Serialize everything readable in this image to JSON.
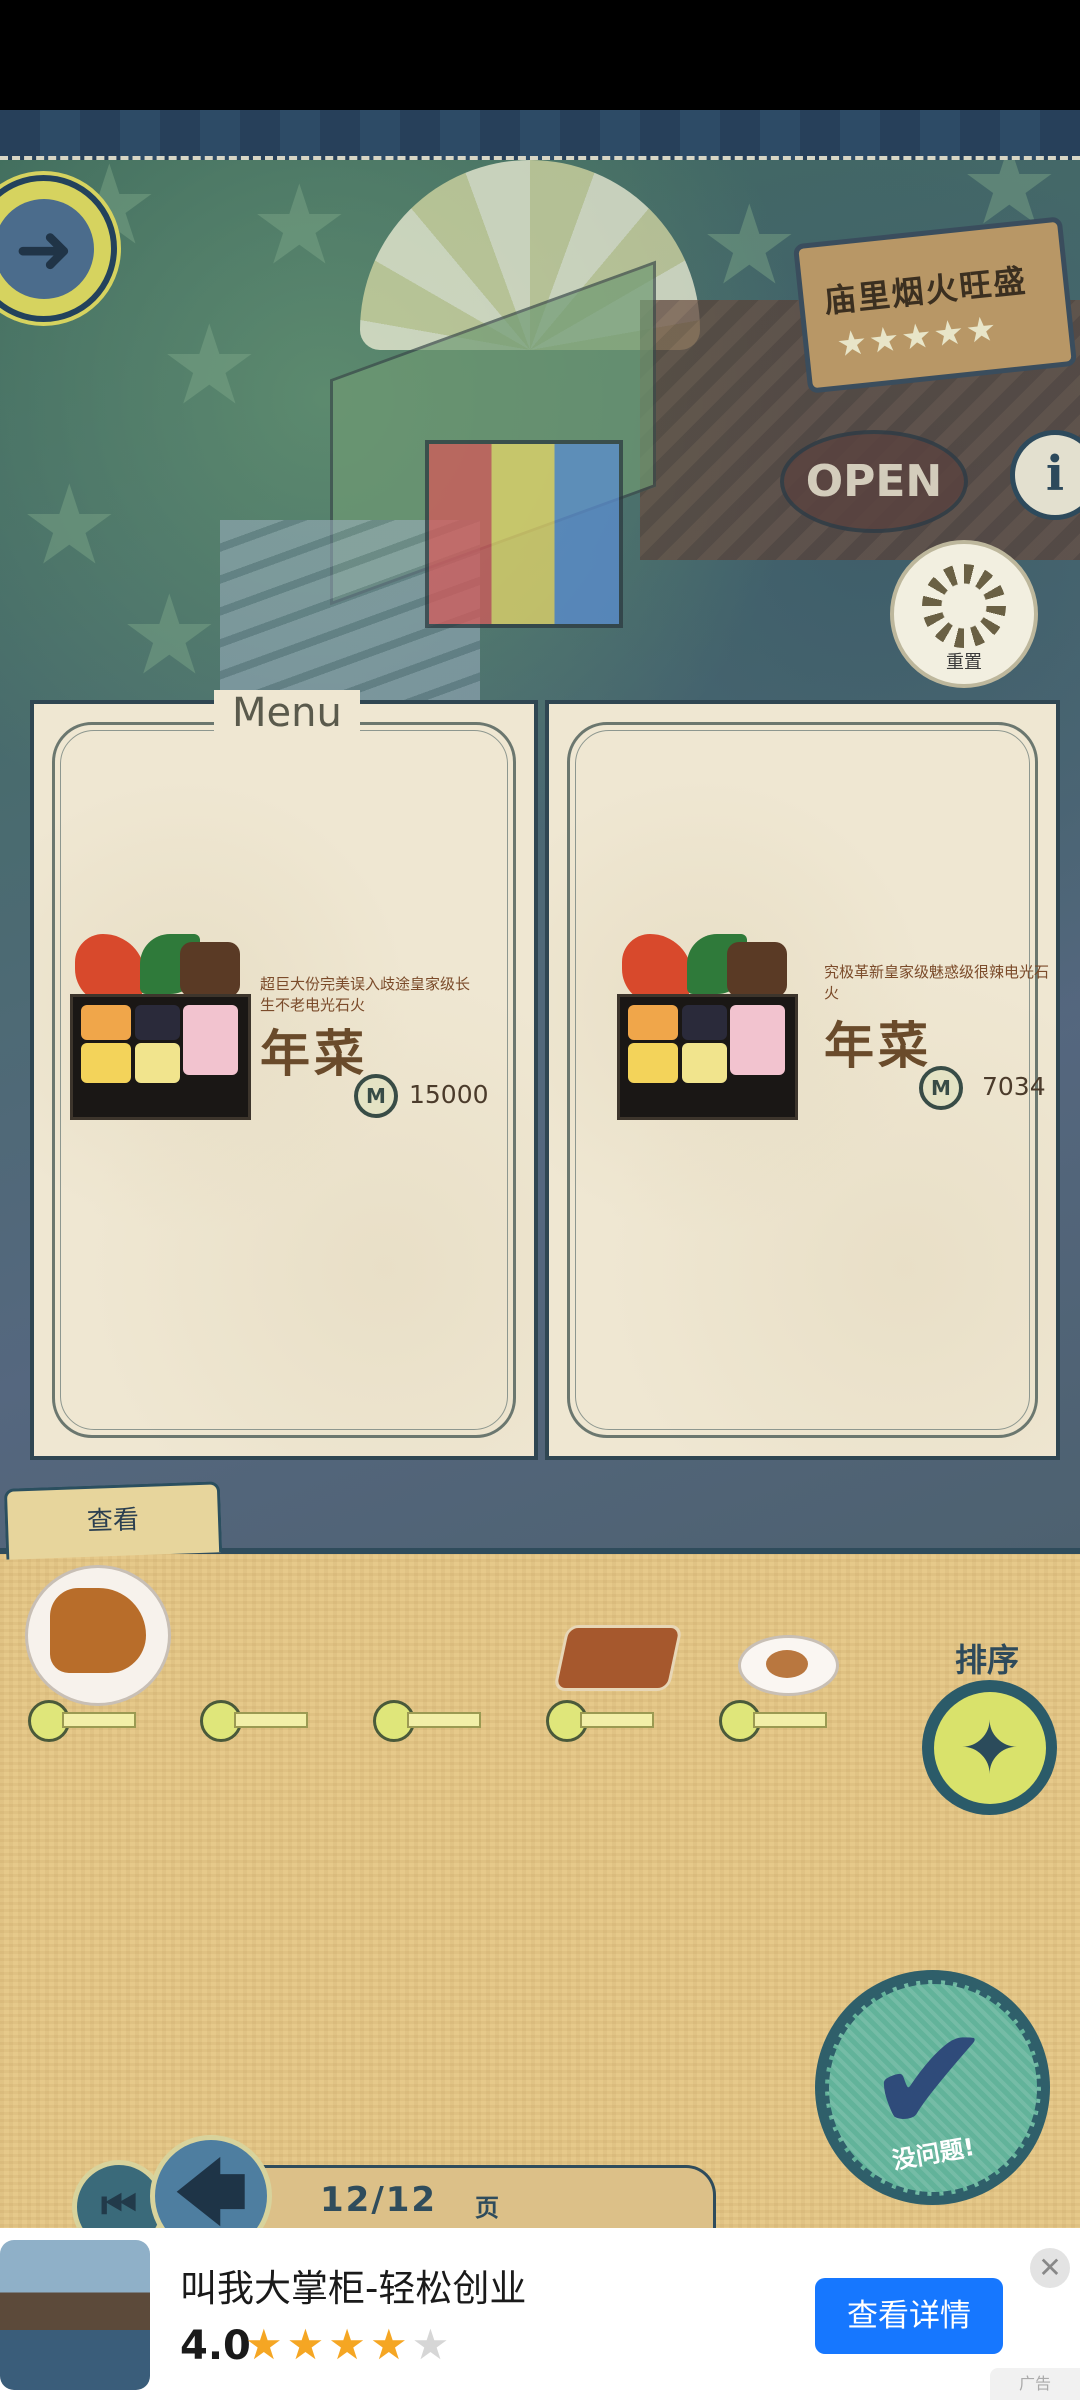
{
  "shop": {
    "sign_text": "庙里烟火旺盛",
    "sign_stars": "★★★★★",
    "open_text": "OPEN"
  },
  "hud": {
    "info_icon": "i",
    "reset_label": "重置"
  },
  "menu": {
    "title": "Menu",
    "dishes": [
      {
        "description": "超巨大份完美误入歧途皇家级长生不老电光石火",
        "name": "年菜",
        "coin_icon": "M",
        "price": "15000"
      },
      {
        "description": "究极革新皇家级魅惑级很辣电光石火",
        "name": "年菜",
        "coin_icon": "M",
        "price": "7034"
      }
    ]
  },
  "panel": {
    "view_tab": "查看",
    "sort_label": "排序",
    "sort_icon": "✦",
    "confirm_label": "没问题!",
    "confirm_icon": "✔"
  },
  "pagination": {
    "first_icon": "⏮",
    "prev_icon": "🡄",
    "page": "12/12",
    "unit": "页"
  },
  "ad": {
    "title": "叫我大掌柜-轻松创业",
    "rating": "4.0",
    "stars_filled": "★★★★",
    "stars_empty": "★",
    "cta": "查看详情",
    "close": "✕",
    "badge": "广告"
  }
}
